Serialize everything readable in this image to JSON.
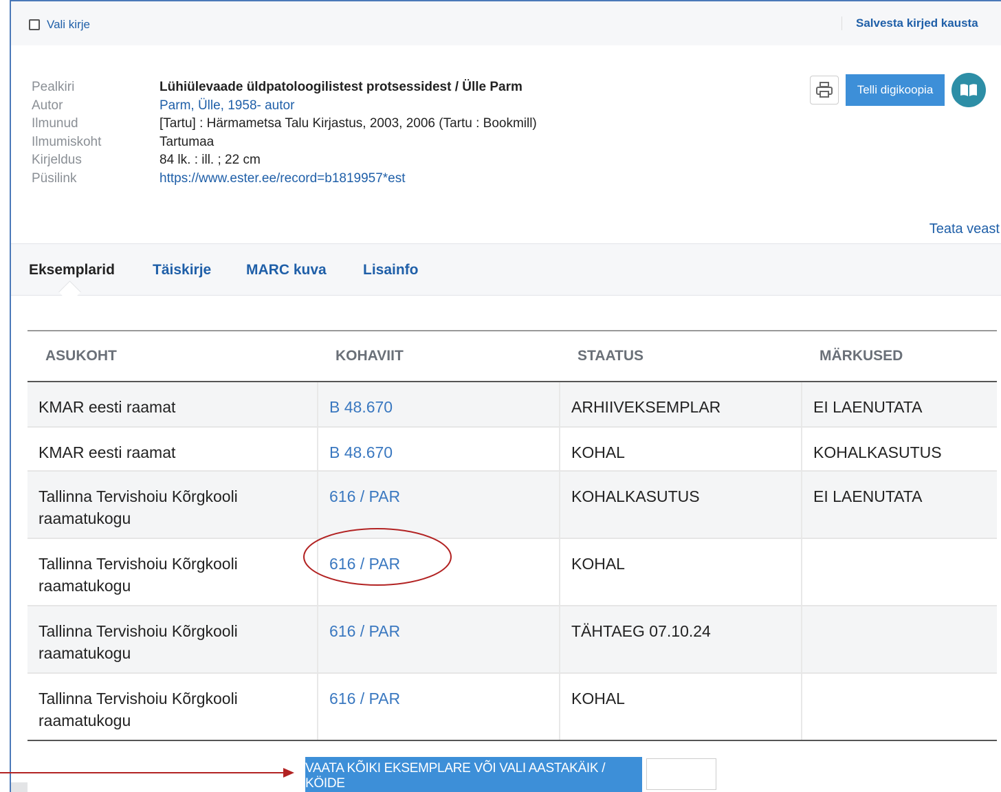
{
  "topbar": {
    "select_label": "Vali kirje",
    "save_to_folder": "Salvesta kirjed kausta"
  },
  "record": {
    "fields": [
      {
        "label": "Pealkiri",
        "value": "Lühiülevaade üldpatoloogilistest protsessidest / Ülle Parm"
      },
      {
        "label": "Autor",
        "value": "Parm, Ülle, 1958- autor"
      },
      {
        "label": "Ilmunud",
        "value": "[Tartu] : Härmametsa Talu Kirjastus, 2003, 2006 (Tartu : Bookmill)"
      },
      {
        "label": "Ilmumiskoht",
        "value": "Tartumaa"
      },
      {
        "label": "Kirjeldus",
        "value": "84 lk. : ill. ; 22 cm"
      },
      {
        "label": "Püsilink",
        "value": "https://www.ester.ee/record=b1819957*est"
      }
    ],
    "order_digital_copy": "Telli digikoopia",
    "report_error": "Teata veast"
  },
  "tabs": [
    {
      "label": "Eksemplarid"
    },
    {
      "label": "Täiskirje"
    },
    {
      "label": "MARC kuva"
    },
    {
      "label": "Lisainfo"
    }
  ],
  "items_table": {
    "headers": [
      "ASUKOHT",
      "KOHAVIIT",
      "STAATUS",
      "MÄRKUSED"
    ],
    "rows": [
      {
        "location": "KMAR eesti raamat",
        "callnumber": "B 48.670",
        "status": "ARHIIVEKSEMPLAR",
        "notes": "EI LAENUTATA"
      },
      {
        "location": "KMAR eesti raamat",
        "callnumber": "B 48.670",
        "status": "KOHAL",
        "notes": "KOHALKASUTUS"
      },
      {
        "location": "Tallinna Tervishoiu Kõrgkooli raamatukogu",
        "callnumber": "616 / PAR",
        "status": "KOHALKASUTUS",
        "notes": "EI LAENUTATA"
      },
      {
        "location": "Tallinna Tervishoiu Kõrgkooli raamatukogu",
        "callnumber": "616 / PAR",
        "status": "KOHAL",
        "notes": ""
      },
      {
        "location": "Tallinna Tervishoiu Kõrgkooli raamatukogu",
        "callnumber": "616 / PAR",
        "status": "TÄHTAEG 07.10.24",
        "notes": ""
      },
      {
        "location": "Tallinna Tervishoiu Kõrgkooli raamatukogu",
        "callnumber": "616 / PAR",
        "status": "KOHAL",
        "notes": ""
      }
    ]
  },
  "show_all_button": "VAATA KÕIKI EKSEMPLARE VÕI VALI AASTAKÄIK / KÖIDE",
  "volume_input": {
    "value": ""
  },
  "colors": {
    "accent": "#3d8fd8",
    "link": "#1f5fa8",
    "annotation": "#b22222",
    "book_icon_bg": "#2d8ea6"
  },
  "icons": [
    "checkbox-icon",
    "printer-icon",
    "open-book-icon"
  ]
}
